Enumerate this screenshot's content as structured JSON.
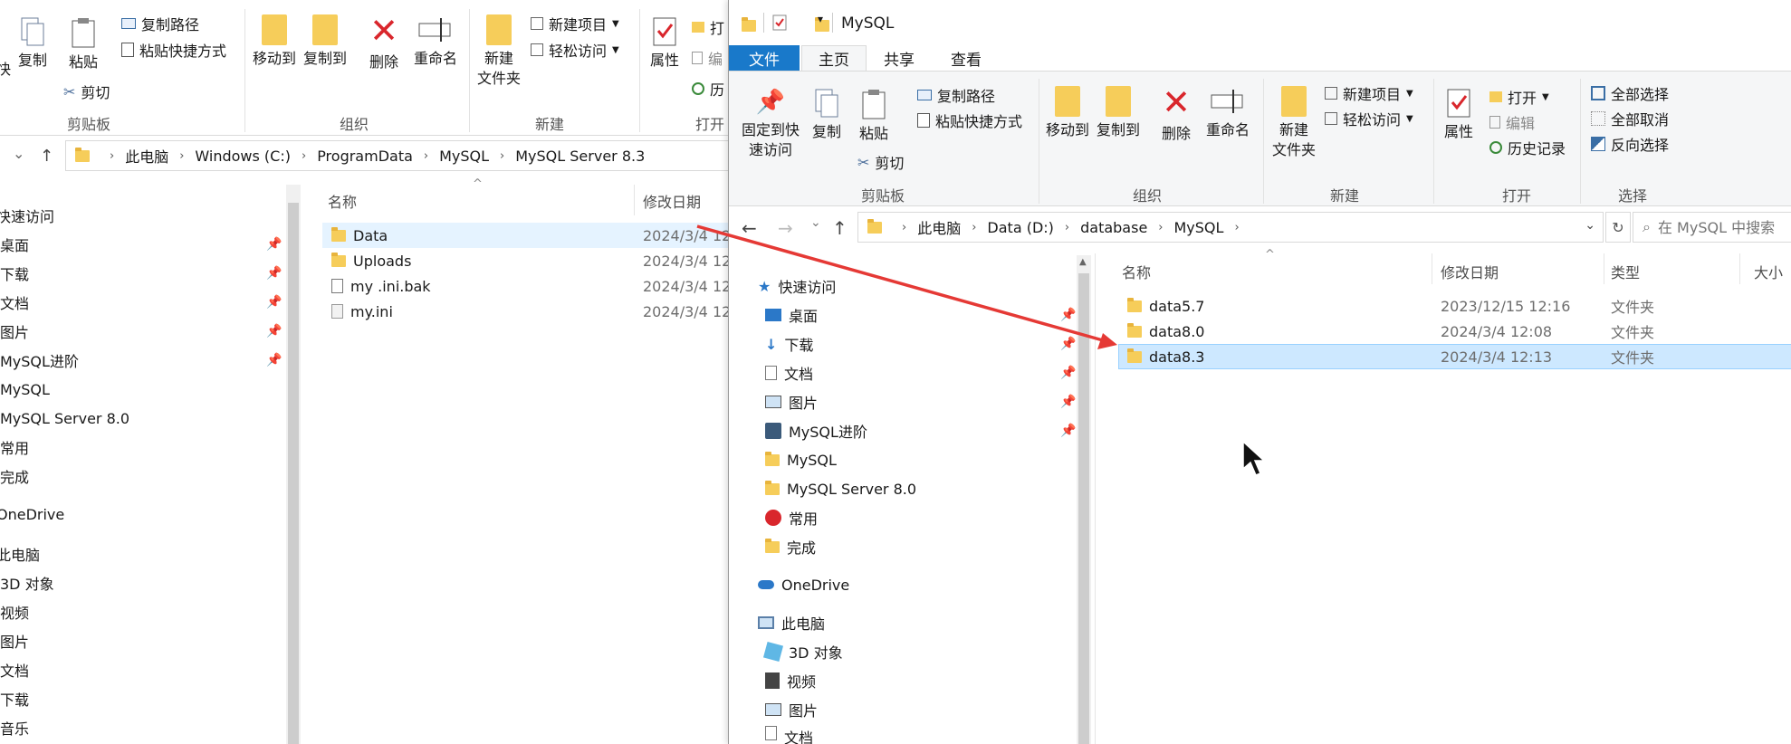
{
  "back_window": {
    "ribbon": {
      "buttons": {
        "pin_partial": "快",
        "copy": "复制",
        "paste": "粘贴",
        "copy_path": "复制路径",
        "paste_shortcut": "粘贴快捷方式",
        "cut": "剪切",
        "move_to": "移动到",
        "copy_to": "复制到",
        "delete": "删除",
        "rename": "重命名",
        "new_folder_line1": "新建",
        "new_folder_line2": "文件夹",
        "new_item": "新建项目",
        "easy_access": "轻松访问",
        "properties": "属性",
        "open_partial": "打",
        "edit_partial": "编",
        "history_partial": "历"
      },
      "groups": {
        "clipboard": "剪贴板",
        "organize": "组织",
        "new": "新建",
        "open_partial": "打开"
      }
    },
    "address": {
      "crumbs": [
        "此电脑",
        "Windows (C:)",
        "ProgramData",
        "MySQL",
        "MySQL Server 8.3"
      ]
    },
    "nav": {
      "quick_access": "快速访问",
      "items": [
        "桌面",
        "下载",
        "文档",
        "图片",
        "MySQL进阶",
        "MySQL",
        "MySQL Server 8.0",
        "常用",
        "完成"
      ],
      "onedrive": "OneDrive",
      "this_pc": "此电脑",
      "pc_items": [
        "3D 对象",
        "视频",
        "图片",
        "文档",
        "下载",
        "音乐"
      ]
    },
    "columns": {
      "name": "名称",
      "date": "修改日期"
    },
    "files": [
      {
        "name": "Data",
        "date": "2024/3/4 12",
        "kind": "folder"
      },
      {
        "name": "Uploads",
        "date": "2024/3/4 12",
        "kind": "folder"
      },
      {
        "name": "my .ini.bak",
        "date": "2024/3/4 12",
        "kind": "file"
      },
      {
        "name": "my.ini",
        "date": "2024/3/4 12",
        "kind": "ini"
      }
    ]
  },
  "front_window": {
    "title": "MySQL",
    "tabs": {
      "file": "文件",
      "home": "主页",
      "share": "共享",
      "view": "查看"
    },
    "ribbon": {
      "buttons": {
        "pin_line1": "固定到快",
        "pin_line2": "速访问",
        "copy": "复制",
        "paste": "粘贴",
        "copy_path": "复制路径",
        "paste_shortcut": "粘贴快捷方式",
        "cut": "剪切",
        "move_to": "移动到",
        "copy_to": "复制到",
        "delete": "删除",
        "rename": "重命名",
        "new_folder_line1": "新建",
        "new_folder_line2": "文件夹",
        "new_item": "新建项目",
        "easy_access": "轻松访问",
        "properties": "属性",
        "open": "打开",
        "edit": "编辑",
        "history": "历史记录",
        "select_all": "全部选择",
        "select_none": "全部取消",
        "invert_select": "反向选择"
      },
      "groups": {
        "clipboard": "剪贴板",
        "organize": "组织",
        "new": "新建",
        "open": "打开",
        "select": "选择"
      }
    },
    "address": {
      "crumbs": [
        "此电脑",
        "Data (D:)",
        "database",
        "MySQL"
      ],
      "search_placeholder": "在 MySQL 中搜索"
    },
    "nav": {
      "quick_access": "快速访问",
      "items": [
        "桌面",
        "下载",
        "文档",
        "图片",
        "MySQL进阶",
        "MySQL",
        "MySQL Server 8.0",
        "常用",
        "完成"
      ],
      "onedrive": "OneDrive",
      "this_pc": "此电脑",
      "pc_items": [
        "3D 对象",
        "视频",
        "图片",
        "文档"
      ]
    },
    "columns": {
      "name": "名称",
      "date": "修改日期",
      "type": "类型",
      "size": "大小"
    },
    "files": [
      {
        "name": "data5.7",
        "date": "2023/12/15 12:16",
        "type": "文件夹"
      },
      {
        "name": "data8.0",
        "date": "2024/3/4 12:08",
        "type": "文件夹"
      },
      {
        "name": "data8.3",
        "date": "2024/3/4 12:13",
        "type": "文件夹"
      }
    ]
  },
  "colors": {
    "accent": "#1979ca",
    "arrow": "#e53935",
    "selection": "#cde8ff"
  }
}
